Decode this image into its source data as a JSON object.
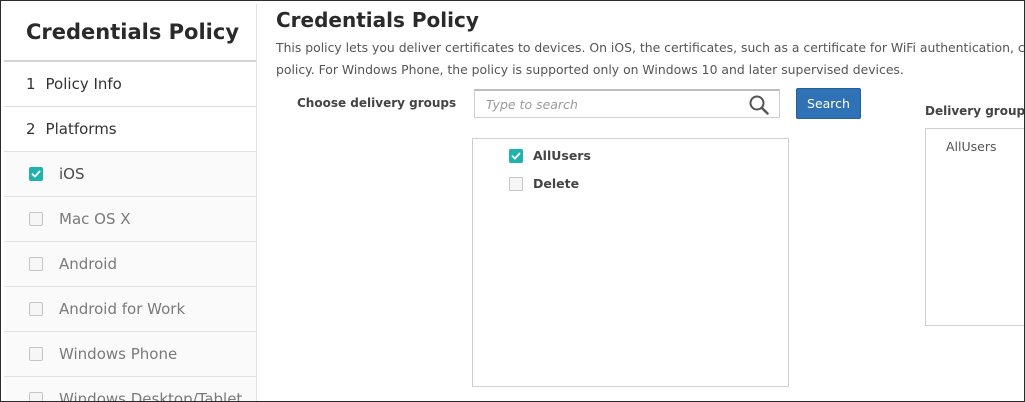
{
  "sidebar": {
    "title": "Credentials Policy",
    "steps": [
      {
        "number": "1",
        "label": "Policy Info"
      },
      {
        "number": "2",
        "label": "Platforms"
      }
    ],
    "platforms": [
      {
        "label": "iOS",
        "checked": true
      },
      {
        "label": "Mac OS X",
        "checked": false
      },
      {
        "label": "Android",
        "checked": false
      },
      {
        "label": "Android for Work",
        "checked": false
      },
      {
        "label": "Windows Phone",
        "checked": false
      },
      {
        "label": "Windows Desktop/Tablet",
        "checked": false
      }
    ]
  },
  "main": {
    "title": "Credentials Policy",
    "description_lines": [
      "This policy lets you deliver certificates to devices. On iOS, the certificates, such as a certificate for WiFi authentication, can",
      "policy. For Windows Phone, the policy is supported only on Windows 10 and later supervised devices."
    ],
    "choose_label": "Choose delivery groups",
    "search": {
      "placeholder": "Type to search",
      "value": "",
      "button_label": "Search"
    },
    "groups": [
      {
        "label": "AllUsers",
        "checked": true
      },
      {
        "label": "Delete",
        "checked": false
      }
    ],
    "delivery_groups": {
      "label": "Delivery groups",
      "items": [
        "AllUsers"
      ]
    }
  },
  "colors": {
    "accent_check": "#1fb3b0",
    "button": "#2f73b6"
  }
}
